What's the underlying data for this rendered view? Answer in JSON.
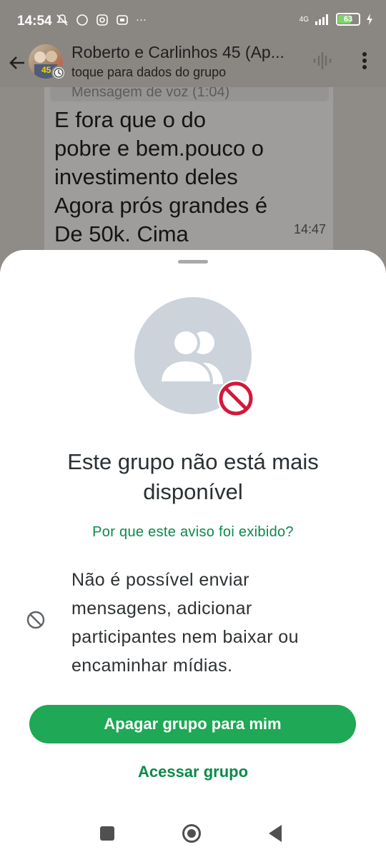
{
  "status_bar": {
    "time": "14:54",
    "more": "···",
    "network": "4G",
    "battery": "63",
    "battery_level": 0.63
  },
  "header": {
    "title": "Roberto e Carlinhos 45 (Ap...",
    "subtitle": "toque para dados do grupo"
  },
  "chat": {
    "reply_preview": "Mensagem de voz (1:04)",
    "message_text": "E fora que o do\npobre e bem.pouco o\ninvestimento deles\n Agora prós grandes é\n De 50k. Cima",
    "message_time": "14:47"
  },
  "sheet": {
    "title": "Este grupo não está mais disponível",
    "why_link": "Por que este aviso foi exibido?",
    "info_text": "Não é possível enviar mensagens, adicionar participantes nem baixar ou encaminhar mídias.",
    "delete_button": "Apagar grupo para mim",
    "access_button": "Acessar grupo"
  },
  "colors": {
    "accent_green": "#1fa855",
    "link_green": "#0b8a4a",
    "blocked_red": "#d2183c"
  },
  "icons": [
    "back-arrow-icon",
    "voice-chat-icon",
    "more-vert-icon",
    "group-icon",
    "blocked-icon",
    "nav-recents-icon",
    "nav-home-icon",
    "nav-back-icon"
  ]
}
